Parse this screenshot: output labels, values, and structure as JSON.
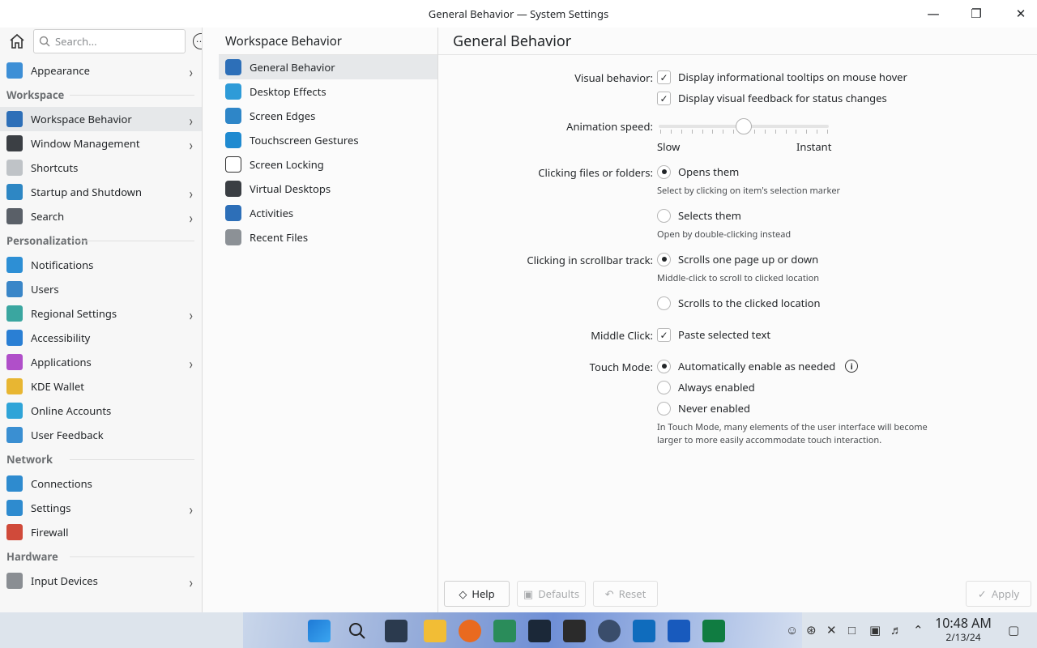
{
  "window": {
    "title": "General Behavior — System Settings"
  },
  "sidebar": {
    "search_placeholder": "Search...",
    "items": [
      {
        "type": "item",
        "label": "Appearance",
        "chevron": true,
        "color": "#3d8fd6"
      },
      {
        "type": "section",
        "label": "Workspace"
      },
      {
        "type": "item",
        "label": "Workspace Behavior",
        "chevron": true,
        "selected": true,
        "color": "#2d6fb8"
      },
      {
        "type": "item",
        "label": "Window Management",
        "chevron": true,
        "color": "#3b3f44"
      },
      {
        "type": "item",
        "label": "Shortcuts",
        "chevron": false,
        "color": "#bfc3c7"
      },
      {
        "type": "item",
        "label": "Startup and Shutdown",
        "chevron": true,
        "color": "#2e87c4"
      },
      {
        "type": "item",
        "label": "Search",
        "chevron": true,
        "color": "#5a6068"
      },
      {
        "type": "section",
        "label": "Personalization"
      },
      {
        "type": "item",
        "label": "Notifications",
        "chevron": false,
        "color": "#2d8fd5"
      },
      {
        "type": "item",
        "label": "Users",
        "chevron": false,
        "color": "#3a86c8"
      },
      {
        "type": "item",
        "label": "Regional Settings",
        "chevron": true,
        "color": "#3aa6a0"
      },
      {
        "type": "item",
        "label": "Accessibility",
        "chevron": false,
        "color": "#2a7fd4"
      },
      {
        "type": "item",
        "label": "Applications",
        "chevron": true,
        "color": "#b04fc9"
      },
      {
        "type": "item",
        "label": "KDE Wallet",
        "chevron": false,
        "color": "#e8b632"
      },
      {
        "type": "item",
        "label": "Online Accounts",
        "chevron": false,
        "color": "#2fa4d8"
      },
      {
        "type": "item",
        "label": "User Feedback",
        "chevron": false,
        "color": "#3a8fd2"
      },
      {
        "type": "section",
        "label": "Network"
      },
      {
        "type": "item",
        "label": "Connections",
        "chevron": false,
        "color": "#2e8bcf"
      },
      {
        "type": "item",
        "label": "Settings",
        "chevron": true,
        "color": "#2e8bcf"
      },
      {
        "type": "item",
        "label": "Firewall",
        "chevron": false,
        "color": "#d04a3a"
      },
      {
        "type": "section",
        "label": "Hardware"
      },
      {
        "type": "item",
        "label": "Input Devices",
        "chevron": true,
        "color": "#8a8e93"
      }
    ]
  },
  "middle": {
    "title": "Workspace Behavior",
    "items": [
      {
        "label": "General Behavior",
        "selected": true,
        "color": "#2d6fb8"
      },
      {
        "label": "Desktop Effects",
        "color": "#2e9bd8"
      },
      {
        "label": "Screen Edges",
        "color": "#2e86c8"
      },
      {
        "label": "Touchscreen Gestures",
        "color": "#1f8ad0"
      },
      {
        "label": "Screen Locking",
        "color": "#ffffff"
      },
      {
        "label": "Virtual Desktops",
        "color": "#3a3e43"
      },
      {
        "label": "Activities",
        "color": "#2d6fb8"
      },
      {
        "label": "Recent Files",
        "color": "#8c9196"
      }
    ]
  },
  "main": {
    "title": "General Behavior",
    "visual_behavior": {
      "label": "Visual behavior:",
      "opt1": "Display informational tooltips on mouse hover",
      "opt2": "Display visual feedback for status changes"
    },
    "animation": {
      "label": "Animation speed:",
      "slow": "Slow",
      "instant": "Instant",
      "level": 0.5
    },
    "clicking_files": {
      "label": "Clicking files or folders:",
      "opt1": "Opens them",
      "hint1": "Select by clicking on item's selection marker",
      "opt2": "Selects them",
      "hint2": "Open by double-clicking instead"
    },
    "scrollbar": {
      "label": "Clicking in scrollbar track:",
      "opt1": "Scrolls one page up or down",
      "hint1": "Middle-click to scroll to clicked location",
      "opt2": "Scrolls to the clicked location"
    },
    "middle_click": {
      "label": "Middle Click:",
      "opt1": "Paste selected text"
    },
    "touch_mode": {
      "label": "Touch Mode:",
      "opt1": "Automatically enable as needed",
      "opt2": "Always enabled",
      "opt3": "Never enabled",
      "hint_line1": "In Touch Mode, many elements of the user interface will become",
      "hint_line2": "larger to more easily accommodate touch interaction."
    },
    "buttons": {
      "help": "Help",
      "defaults": "Defaults",
      "reset": "Reset",
      "apply": "Apply"
    }
  },
  "taskbar": {
    "time": "10:48 AM",
    "date": "2/13/24"
  }
}
